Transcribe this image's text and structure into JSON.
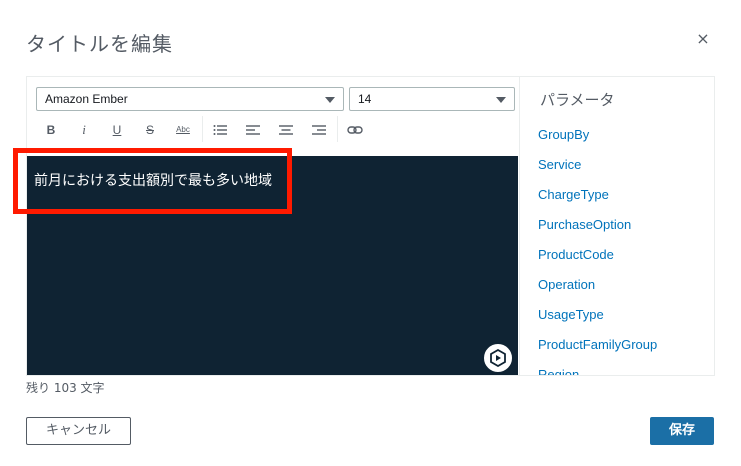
{
  "modal": {
    "title": "タイトルを編集",
    "close_icon": "close-icon",
    "close_glyph": "×"
  },
  "toolbar": {
    "font_family": "Amazon Ember",
    "font_size": "14",
    "buttons": {
      "bold": "B",
      "italic": "i",
      "underline": "U",
      "strikethrough": "S",
      "spellcheck": "Abc"
    },
    "icons": [
      "bold-icon",
      "italic-icon",
      "underline-icon",
      "strikethrough-icon",
      "spellcheck-icon",
      "bullet-list-icon",
      "align-left-icon",
      "align-center-icon",
      "align-right-icon",
      "link-icon"
    ]
  },
  "editor": {
    "content": "前月における支出額別で最も多い地域",
    "background": "#0f2333",
    "highlight_color": "#ff1a00"
  },
  "parameters": {
    "heading": "パラメータ",
    "items": [
      "GroupBy",
      "Service",
      "ChargeType",
      "PurchaseOption",
      "ProductCode",
      "Operation",
      "UsageType",
      "ProductFamilyGroup",
      "Region"
    ]
  },
  "footer": {
    "remaining": "残り 103 文字",
    "cancel_label": "キャンセル",
    "save_label": "保存"
  },
  "colors": {
    "link": "#0073bb",
    "primary_button": "#1b6fa6"
  }
}
